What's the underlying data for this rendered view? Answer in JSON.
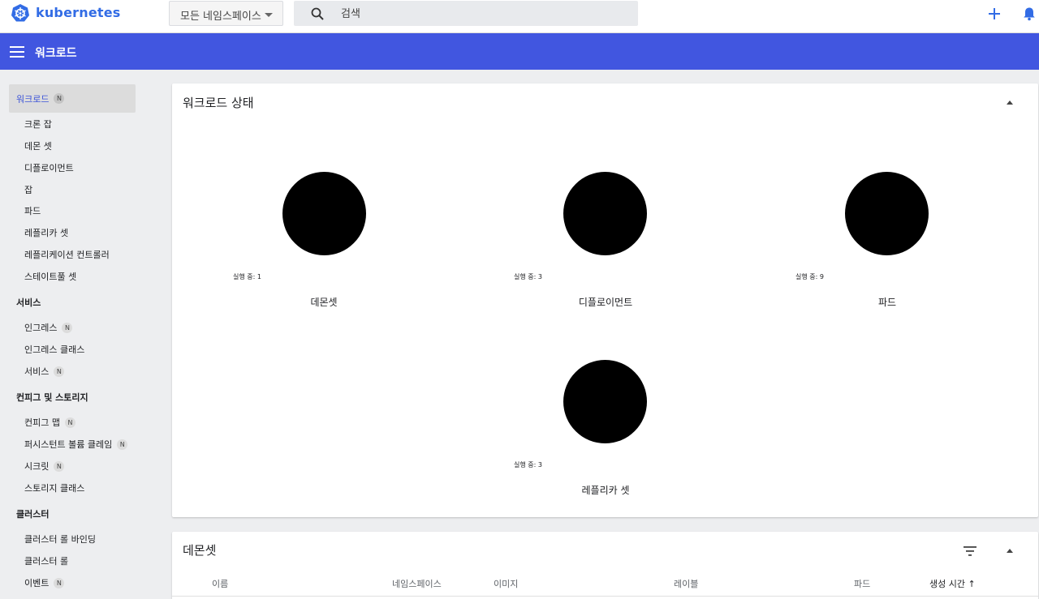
{
  "app": {
    "brand": "kubernetes"
  },
  "toolbar": {
    "namespace_selected": "모든 네임스페이스",
    "search_placeholder": "검색"
  },
  "header": {
    "title": "워크로드"
  },
  "sidebar": {
    "workloads": {
      "label": "워크로드",
      "badge": "N"
    },
    "workload_items": [
      "크론 잡",
      "데몬 셋",
      "디플로이먼트",
      "잡",
      "파드",
      "레플리카 셋",
      "레플리케이션 컨트롤러",
      "스테이트풀 셋"
    ],
    "service_section": "서비스",
    "service_items": [
      {
        "label": "인그레스",
        "badge": "N"
      },
      {
        "label": "인그레스 클래스",
        "badge": ""
      },
      {
        "label": "서비스",
        "badge": "N"
      }
    ],
    "config_section": "컨피그 및 스토리지",
    "config_items": [
      {
        "label": "컨피그 맵",
        "badge": "N"
      },
      {
        "label": "퍼시스턴트 볼륨 클레임",
        "badge": "N"
      },
      {
        "label": "시크릿",
        "badge": "N"
      },
      {
        "label": "스토리지 클래스",
        "badge": ""
      }
    ],
    "cluster_section": "클러스터",
    "cluster_items": [
      {
        "label": "클러스터 롤 바인딩",
        "badge": ""
      },
      {
        "label": "클러스터 롤",
        "badge": ""
      },
      {
        "label": "이벤트",
        "badge": "N"
      }
    ]
  },
  "status_card": {
    "title": "워크로드 상태",
    "items": [
      {
        "running": "실행 중: 1",
        "label": "데몬셋"
      },
      {
        "running": "실행 중: 3",
        "label": "디플로이먼트"
      },
      {
        "running": "실행 중: 9",
        "label": "파드"
      },
      {
        "running": "실행 중: 3",
        "label": "레플리카 셋"
      }
    ]
  },
  "daemonset_card": {
    "title": "데몬셋",
    "columns": [
      "이름",
      "네임스페이스",
      "이미지",
      "레이블",
      "파드",
      "생성 시간 ↑"
    ]
  },
  "colors": {
    "brand": "#326ce5",
    "header_bg": "#4156e0",
    "active_text": "#3d54d8",
    "chart_fill": "#000000"
  },
  "icons": [
    "kubernetes-logo",
    "search-icon",
    "plus-icon",
    "bell-icon",
    "menu-icon",
    "chevron-up-icon",
    "filter-icon",
    "sort-arrow-up-icon"
  ]
}
